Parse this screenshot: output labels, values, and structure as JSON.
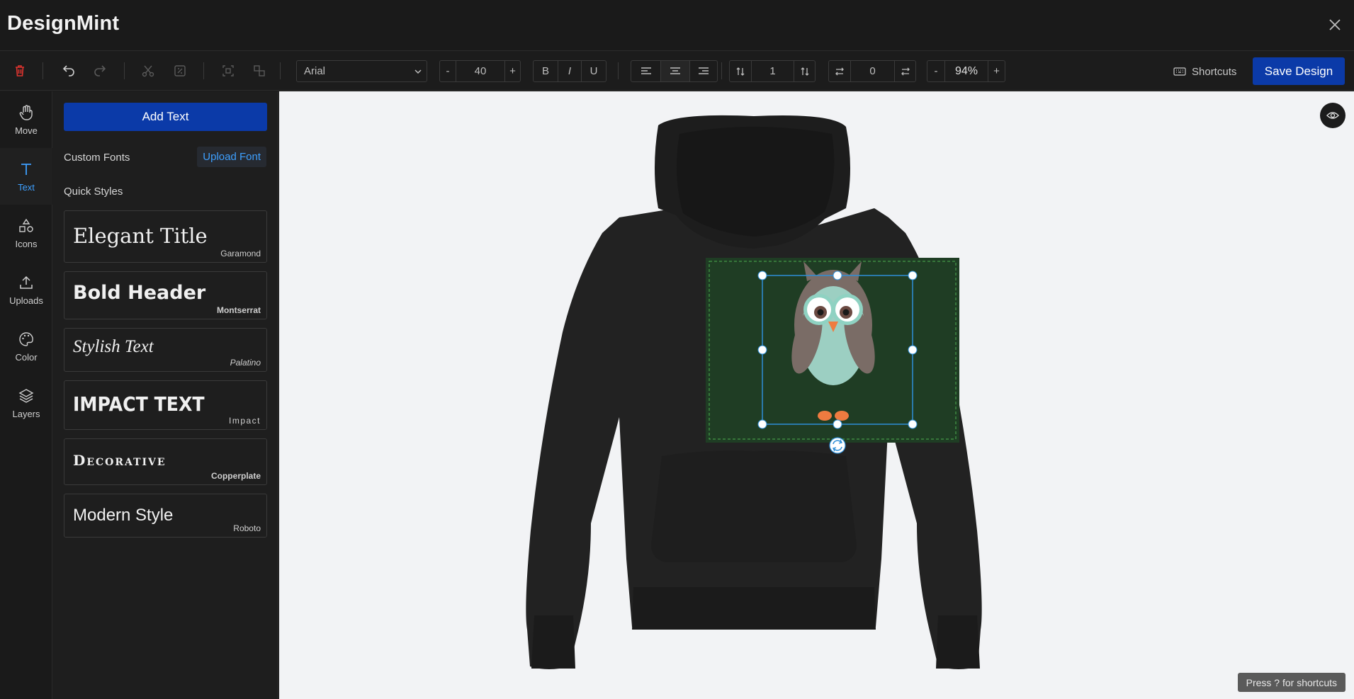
{
  "app": {
    "title": "DesignMint"
  },
  "toolbar": {
    "font_family": "Arial",
    "font_size_minus": "-",
    "font_size": "40",
    "font_size_plus": "+",
    "bold": "B",
    "italic": "I",
    "underline": "U",
    "line_height": "1",
    "letter_spacing": "0",
    "zoom_minus": "-",
    "zoom": "94%",
    "zoom_plus": "+",
    "shortcuts_label": "Shortcuts",
    "save_label": "Save Design"
  },
  "nav": {
    "items": [
      {
        "label": "Move",
        "icon": "hand-icon"
      },
      {
        "label": "Text",
        "icon": "text-icon",
        "active": true
      },
      {
        "label": "Icons",
        "icon": "shapes-icon"
      },
      {
        "label": "Uploads",
        "icon": "upload-icon"
      },
      {
        "label": "Color",
        "icon": "palette-icon"
      },
      {
        "label": "Layers",
        "icon": "layers-icon"
      }
    ]
  },
  "panel": {
    "add_text": "Add Text",
    "custom_fonts": "Custom Fonts",
    "upload_font": "Upload Font",
    "quick_styles": "Quick Styles",
    "styles": [
      {
        "sample": "Elegant Title",
        "font": "Garamond"
      },
      {
        "sample": "Bold Header",
        "font": "Montserrat"
      },
      {
        "sample": "Stylish Text",
        "font": "Palatino"
      },
      {
        "sample": "IMPACT TEXT",
        "font": "Impact"
      },
      {
        "sample": "Decorative",
        "font": "Copperplate"
      },
      {
        "sample": "Modern Style",
        "font": "Roboto"
      }
    ]
  },
  "canvas": {
    "hint": "Press ? for shortcuts"
  },
  "colors": {
    "accent": "#0b3aa8",
    "link": "#3ea0ff",
    "delete": "#e0342f",
    "selection": "#2e8fd8"
  }
}
